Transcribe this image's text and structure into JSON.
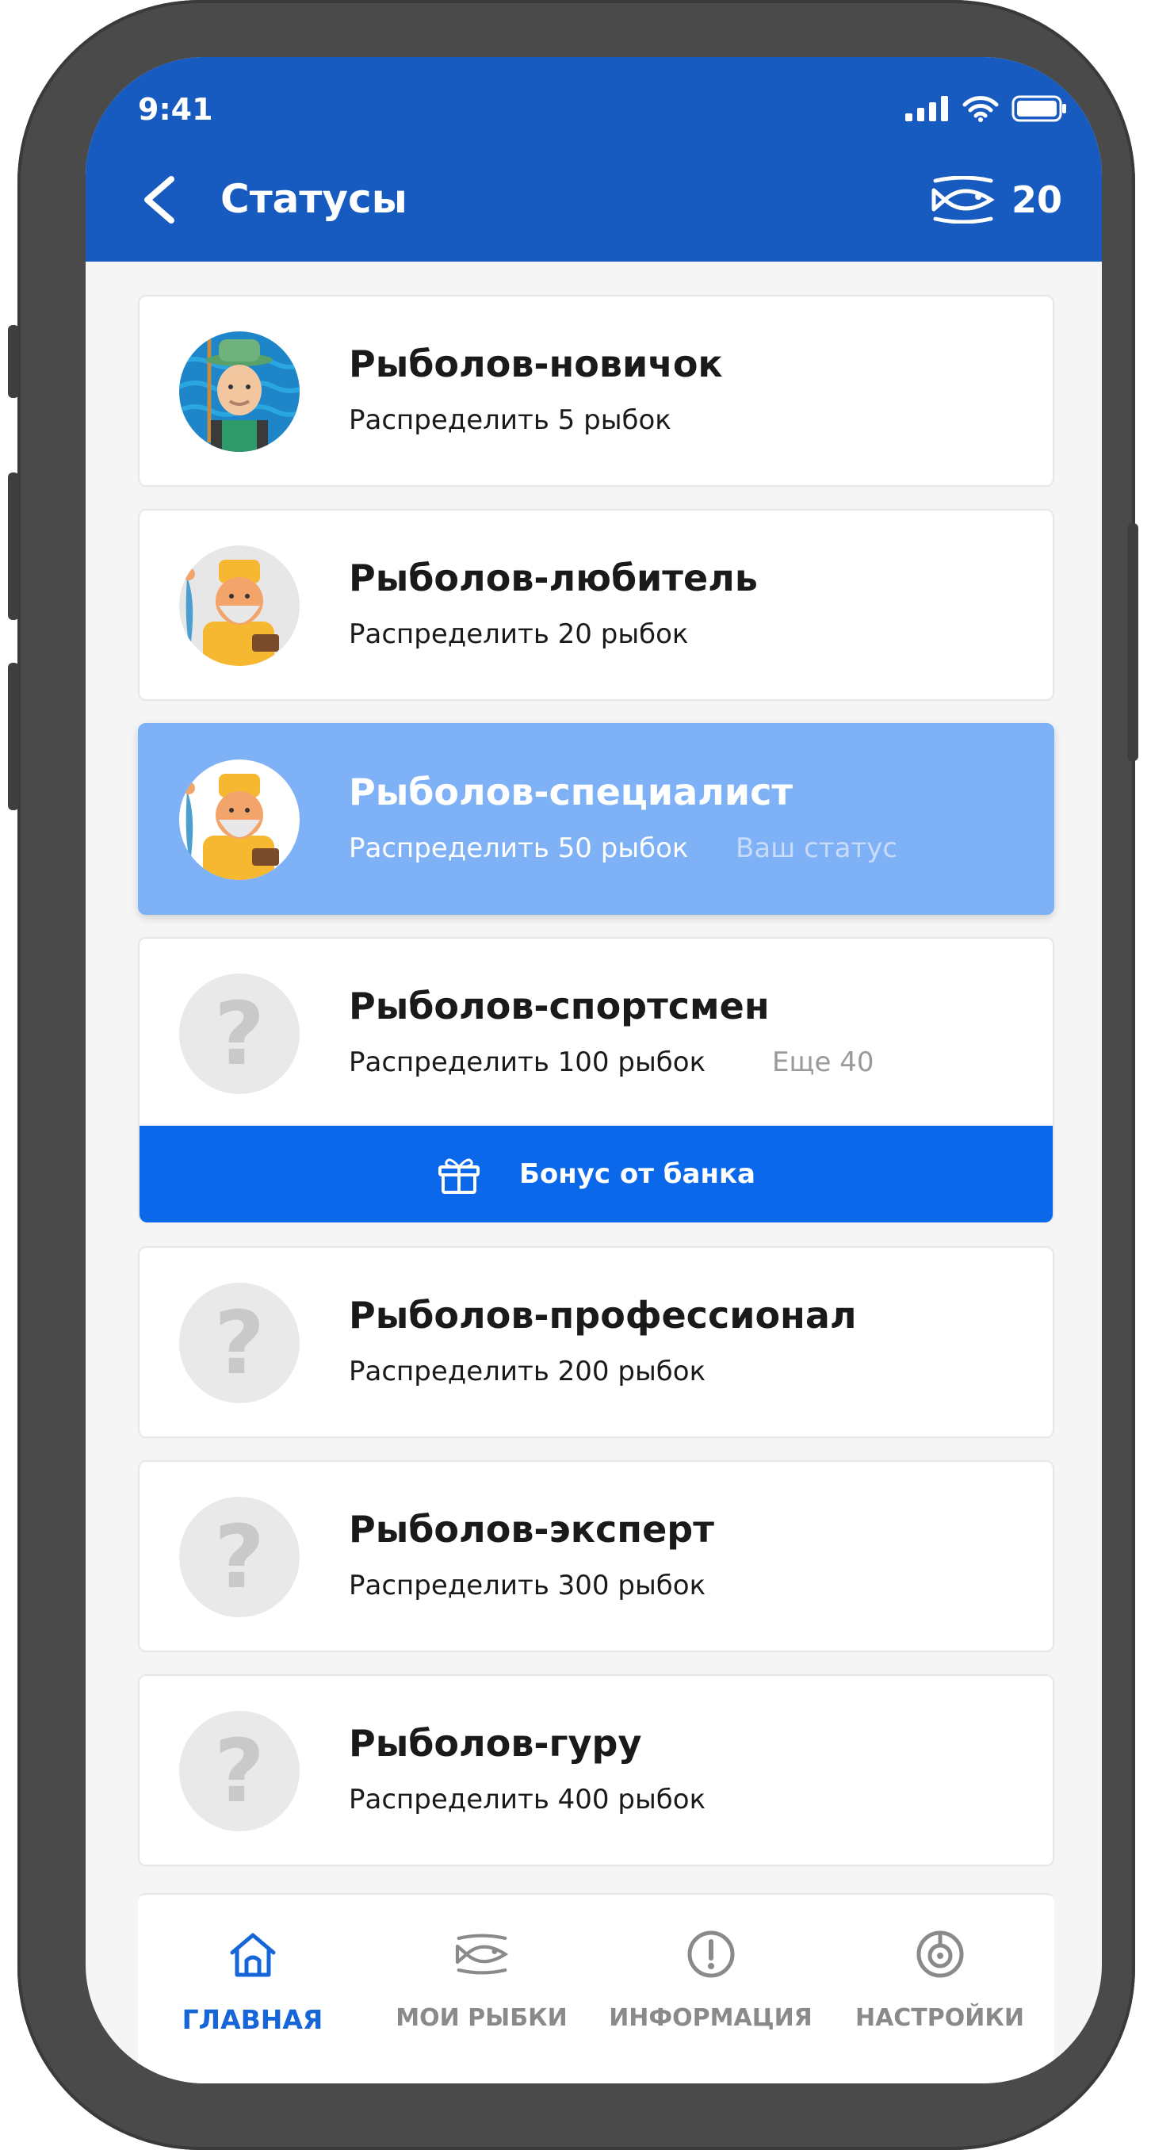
{
  "status_bar": {
    "time": "9:41"
  },
  "header": {
    "title": "Статусы",
    "fish_count": "20"
  },
  "statuses": [
    {
      "title": "Рыболов-новичок",
      "subtitle": "Распределить 5 рыбок",
      "note": ""
    },
    {
      "title": "Рыболов-любитель",
      "subtitle": "Распределить  20 рыбок",
      "note": ""
    },
    {
      "title": "Рыболов-специалист",
      "subtitle": "Распределить 50 рыбок",
      "note": "Ваш статус"
    },
    {
      "title": "Рыболов-спортсмен",
      "subtitle": "Распределить 100 рыбок",
      "note": "Еще 40",
      "bonus_label": "Бонус от банка"
    },
    {
      "title": "Рыболов-профессионал",
      "subtitle": "Распределить 200 рыбок",
      "note": ""
    },
    {
      "title": "Рыболов-эксперт",
      "subtitle": "Распределить 300 рыбок",
      "note": ""
    },
    {
      "title": "Рыболов-гуру",
      "subtitle": "Распределить 400 рыбок",
      "note": ""
    }
  ],
  "locked_mark": "?",
  "tabs": [
    {
      "label": "ГЛАВНАЯ",
      "icon": "home-icon",
      "active": true
    },
    {
      "label": "МОИ РЫБКИ",
      "icon": "fish-icon",
      "active": false
    },
    {
      "label": "ИНФОРМАЦИЯ",
      "icon": "info-icon",
      "active": false
    },
    {
      "label": "НАСТРОЙКИ",
      "icon": "settings-icon",
      "active": false
    }
  ],
  "colors": {
    "primary": "#175ac0",
    "bonus": "#0b68ea",
    "active_card": "#7fb1f6",
    "active_tab": "#1766d8"
  }
}
